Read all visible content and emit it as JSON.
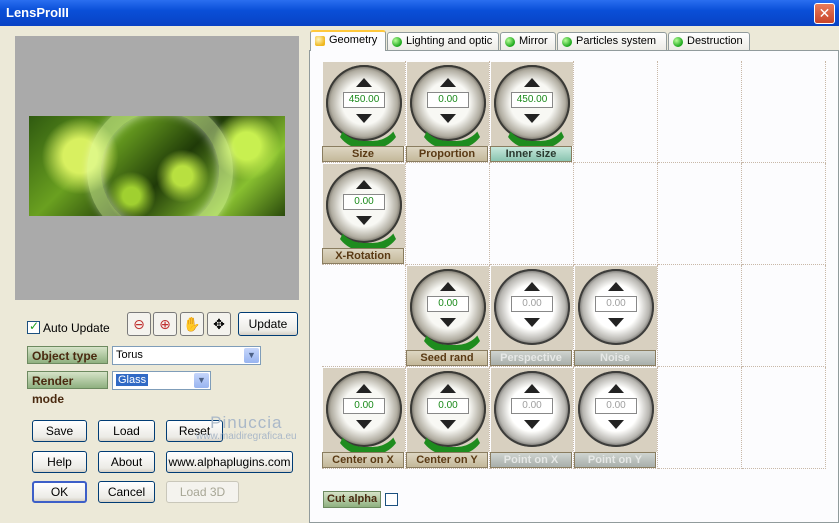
{
  "window": {
    "title": "LensProIII",
    "close_glyph": "✕"
  },
  "left": {
    "auto_update_label": "Auto Update",
    "auto_update_checked": true,
    "update_button": "Update",
    "object_type": {
      "label": "Object type",
      "value": "Torus"
    },
    "render_mode": {
      "label": "Render mode",
      "value": "Glass"
    },
    "tools": [
      {
        "name": "zoom-out-icon",
        "glyph": "⊖"
      },
      {
        "name": "zoom-in-icon",
        "glyph": "⊕"
      },
      {
        "name": "hand-icon",
        "glyph": "✋"
      },
      {
        "name": "move-icon",
        "glyph": "✥"
      }
    ],
    "buttons": {
      "save": "Save",
      "load": "Load",
      "reset": "Reset",
      "help": "Help",
      "about": "About",
      "website": "www.alphaplugins.com",
      "ok": "OK",
      "cancel": "Cancel",
      "load3d": "Load 3D"
    },
    "watermark": {
      "line1": "Pinuccia",
      "line2": "www.maidiregrafica.eu"
    }
  },
  "tabs": [
    "Geometry",
    "Lighting and optic",
    "Mirror",
    "Particles system",
    "Destruction"
  ],
  "knobs": [
    {
      "label": "Size",
      "value": "450.00",
      "style": "normal",
      "enabled": true
    },
    {
      "label": "Proportion",
      "value": "0.00",
      "style": "normal",
      "enabled": true
    },
    {
      "label": "Inner size",
      "value": "450.00",
      "style": "teal",
      "enabled": true
    },
    {
      "label": "X-Rotation",
      "value": "0.00",
      "style": "normal",
      "enabled": true
    },
    {
      "label": "Seed rand",
      "value": "0.00",
      "style": "normal",
      "enabled": true
    },
    {
      "label": "Perspective",
      "value": "0.00",
      "style": "dim",
      "enabled": false
    },
    {
      "label": "Noise",
      "value": "0.00",
      "style": "dim",
      "enabled": false
    },
    {
      "label": "Center on X",
      "value": "0.00",
      "style": "normal",
      "enabled": true
    },
    {
      "label": "Center on Y",
      "value": "0.00",
      "style": "normal",
      "enabled": true
    },
    {
      "label": "Point on X",
      "value": "0.00",
      "style": "dim",
      "enabled": false
    },
    {
      "label": "Point on Y",
      "value": "0.00",
      "style": "dim",
      "enabled": false
    }
  ],
  "cut_alpha": {
    "label": "Cut alpha",
    "checked": false
  }
}
